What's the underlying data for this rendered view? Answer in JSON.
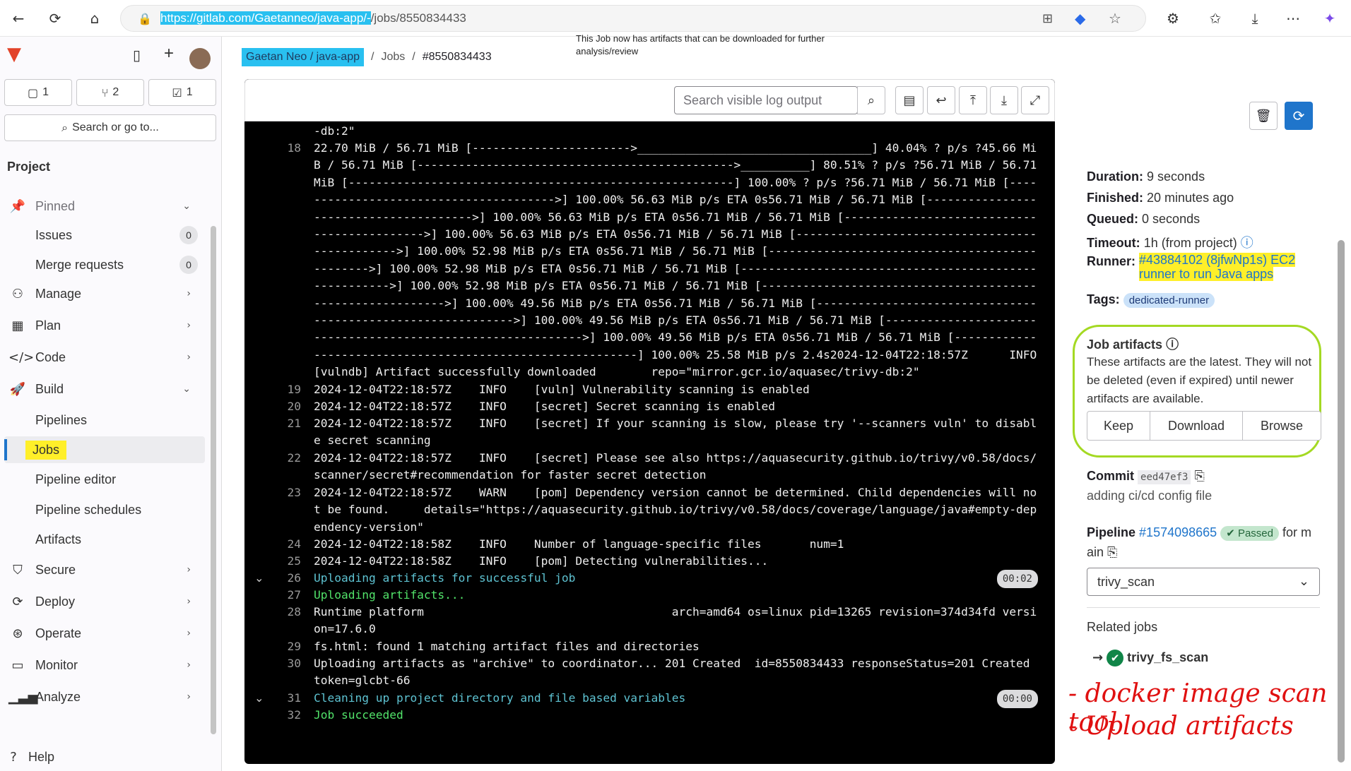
{
  "browser": {
    "url_prefix": "https://gitlab.com/Gaetanneo/java-app/-",
    "url_suffix": "/jobs/8550834433"
  },
  "sidebar": {
    "counts": {
      "issues_btn": "1",
      "mr_btn": "2",
      "todo_btn": "1"
    },
    "search_label": "Search or go to...",
    "section_title": "Project",
    "pinned": "Pinned",
    "issues": "Issues",
    "issues_count": "0",
    "merge_requests": "Merge requests",
    "mr_count": "0",
    "items": {
      "manage": "Manage",
      "plan": "Plan",
      "code": "Code",
      "build": "Build",
      "secure": "Secure",
      "deploy": "Deploy",
      "operate": "Operate",
      "monitor": "Monitor",
      "analyze": "Analyze"
    },
    "build_sub": {
      "pipelines": "Pipelines",
      "jobs": "Jobs",
      "pipeline_editor": "Pipeline editor",
      "pipeline_schedules": "Pipeline schedules",
      "artifacts": "Artifacts"
    },
    "help": "Help"
  },
  "breadcrumb": {
    "owner": "Gaetan Neo",
    "project": "java-app",
    "jobs": "Jobs",
    "job_id": "#8550834433"
  },
  "annotation_top": "This Job now has artifacts that can be downloaded for further analysis/review",
  "log": {
    "search_placeholder": "Search visible log output",
    "lines": [
      {
        "n": "",
        "t": "-db:2\"",
        "cls": ""
      },
      {
        "n": "18",
        "t": "22.70 MiB / 56.71 MiB [----------------------->__________________________________] 40.04% ? p/s ?45.66 MiB / 56.71 MiB [---------------------------------------------->__________] 80.51% ? p/s ?56.71 MiB / 56.71 MiB [--------------------------------------------------------] 100.00% ? p/s ?56.71 MiB / 56.71 MiB [--------------------------------------->] 100.00% 56.63 MiB p/s ETA 0s56.71 MiB / 56.71 MiB [--------------------------------------->] 100.00% 56.63 MiB p/s ETA 0s56.71 MiB / 56.71 MiB [-------------------------------------------->] 100.00% 56.63 MiB p/s ETA 0s56.71 MiB / 56.71 MiB [----------------------------------------------->] 100.00% 52.98 MiB p/s ETA 0s56.71 MiB / 56.71 MiB [----------------------------------------------->] 100.00% 52.98 MiB p/s ETA 0s56.71 MiB / 56.71 MiB [------------------------------------------------------>] 100.00% 52.98 MiB p/s ETA 0s56.71 MiB / 56.71 MiB [----------------------------------------------------------->] 100.00% 49.56 MiB p/s ETA 0s56.71 MiB / 56.71 MiB [------------------------------------------------------------->] 100.00% 49.56 MiB p/s ETA 0s56.71 MiB / 56.71 MiB [------------------------------------------------------------->] 100.00% 49.56 MiB p/s ETA 0s56.71 MiB / 56.71 MiB [-----------------------------------------------------------] 100.00% 25.58 MiB p/s 2.4s2024-12-04T22:18:57Z      INFO    [vulndb] Artifact successfully downloaded        repo=\"mirror.gcr.io/aquasec/trivy-db:2\"",
        "cls": ""
      },
      {
        "n": "19",
        "t": "2024-12-04T22:18:57Z    INFO    [vuln] Vulnerability scanning is enabled",
        "cls": ""
      },
      {
        "n": "20",
        "t": "2024-12-04T22:18:57Z    INFO    [secret] Secret scanning is enabled",
        "cls": ""
      },
      {
        "n": "21",
        "t": "2024-12-04T22:18:57Z    INFO    [secret] If your scanning is slow, please try '--scanners vuln' to disable secret scanning",
        "cls": ""
      },
      {
        "n": "22",
        "t": "2024-12-04T22:18:57Z    INFO    [secret] Please see also https://aquasecurity.github.io/trivy/v0.58/docs/scanner/secret#recommendation for faster secret detection",
        "cls": ""
      },
      {
        "n": "23",
        "t": "2024-12-04T22:18:57Z    WARN    [pom] Dependency version cannot be determined. Child dependencies will not be found.     details=\"https://aquasecurity.github.io/trivy/v0.58/docs/coverage/language/java#empty-dependency-version\"",
        "cls": ""
      },
      {
        "n": "24",
        "t": "2024-12-04T22:18:58Z    INFO    Number of language-specific files       num=1",
        "cls": ""
      },
      {
        "n": "25",
        "t": "2024-12-04T22:18:58Z    INFO    [pom] Detecting vulnerabilities...",
        "cls": ""
      },
      {
        "n": "26",
        "t": "Uploading artifacts for successful job",
        "cls": "sec",
        "time": "00:02"
      },
      {
        "n": "27",
        "t": "Uploading artifacts...",
        "cls": "gr"
      },
      {
        "n": "28",
        "t": "Runtime platform                                    arch=amd64 os=linux pid=13265 revision=374d34fd version=17.6.0",
        "cls": ""
      },
      {
        "n": "29",
        "t": "fs.html: found 1 matching artifact files and directories",
        "cls": ""
      },
      {
        "n": "30",
        "t": "Uploading artifacts as \"archive\" to coordinator... 201 Created  id=8550834433 responseStatus=201 Created token=glcbt-66",
        "cls": ""
      },
      {
        "n": "31",
        "t": "Cleaning up project directory and file based variables",
        "cls": "sec",
        "time": "00:00"
      },
      {
        "n": "32",
        "t": "Job succeeded",
        "cls": "gr"
      }
    ]
  },
  "details": {
    "duration_label": "Duration:",
    "duration": "9 seconds",
    "finished_label": "Finished:",
    "finished": "20 minutes ago",
    "queued_label": "Queued:",
    "queued": "0 seconds",
    "timeout_label": "Timeout:",
    "timeout": "1h (from project)",
    "runner_label": "Runner:",
    "runner_1": "#43884102 (8jfwNp1s) EC2",
    "runner_2": "runner to run Java apps",
    "tags_label": "Tags:",
    "tag": "dedicated-runner",
    "artifacts_title": "Job artifacts",
    "artifacts_desc": "These artifacts are the latest. They will not be deleted (even if expired) until newer artifacts are available.",
    "keep": "Keep",
    "download": "Download",
    "browse": "Browse",
    "commit_label": "Commit",
    "commit_sha": "eed47ef3",
    "commit_msg": "adding ci/cd config file",
    "pipeline_label": "Pipeline",
    "pipeline_id": "#1574098665",
    "pipeline_status": "Passed",
    "pipeline_for": "for m",
    "pipeline_ref": "ain",
    "stage": "trivy_scan",
    "related_title": "Related jobs",
    "related_job": "trivy_fs_scan"
  },
  "handwritten": {
    "line1": "- docker image scan tool",
    "line2": "- Upload artifacts"
  }
}
